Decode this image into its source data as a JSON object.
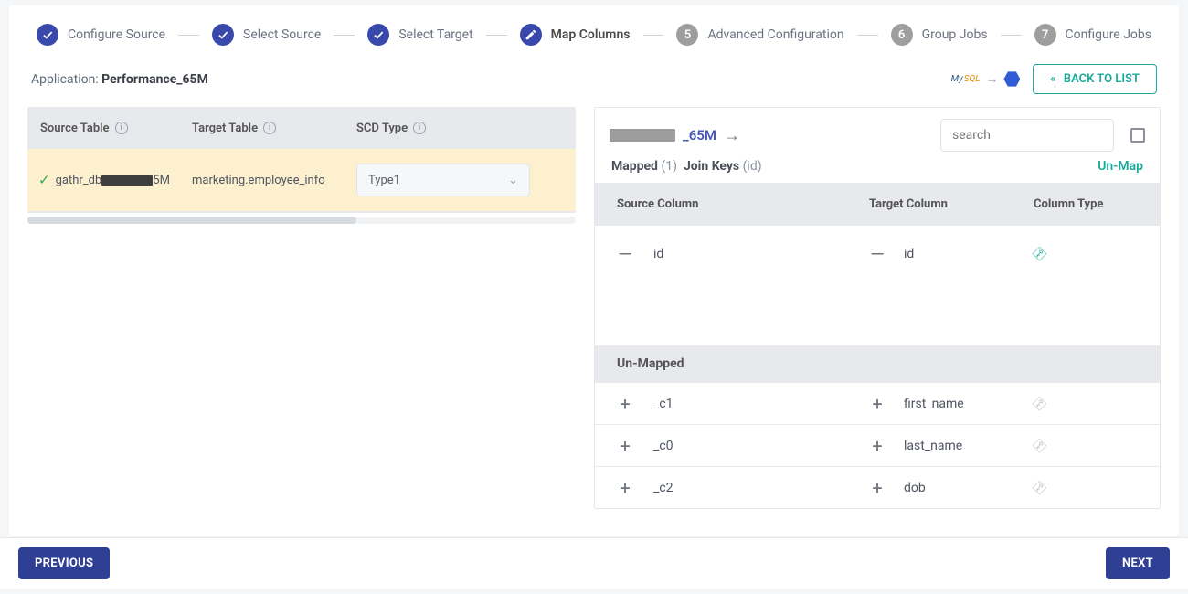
{
  "stepper": {
    "steps": [
      {
        "label": "Configure Source",
        "state": "done"
      },
      {
        "label": "Select Source",
        "state": "done"
      },
      {
        "label": "Select Target",
        "state": "done"
      },
      {
        "label": "Map Columns",
        "state": "current"
      },
      {
        "label": "Advanced Configuration",
        "state": "todo",
        "num": "5"
      },
      {
        "label": "Group Jobs",
        "state": "todo",
        "num": "6"
      },
      {
        "label": "Configure Jobs",
        "state": "todo",
        "num": "7"
      }
    ]
  },
  "header": {
    "application_label": "Application: ",
    "application_name": "Performance_65M",
    "back_to_list": "BACK TO LIST"
  },
  "left_table": {
    "headers": {
      "source": "Source Table",
      "target": "Target Table",
      "scd": "SCD Type"
    },
    "row": {
      "source_prefix": "gathr_db",
      "source_suffix": "5M",
      "target": "marketing.employee_info",
      "scd_value": "Type1"
    }
  },
  "right_panel": {
    "title_suffix": "_65M",
    "search_placeholder": "search",
    "mapped_label": "Mapped",
    "mapped_count": "(1)",
    "joinkeys_label": "Join Keys",
    "joinkeys_value": "(id)",
    "unmap": "Un-Map",
    "grid_headers": {
      "source": "Source Column",
      "target": "Target Column",
      "type": "Column Type"
    },
    "mapped_rows": [
      {
        "src": "id",
        "tgt": "id",
        "icon": "minus",
        "key": "primary"
      }
    ],
    "unmapped_label": "Un-Mapped",
    "unmapped_rows": [
      {
        "src": "_c1",
        "tgt": "first_name",
        "icon": "plus",
        "key": "gray"
      },
      {
        "src": "_c0",
        "tgt": "last_name",
        "icon": "plus",
        "key": "gray"
      },
      {
        "src": "_c2",
        "tgt": "dob",
        "icon": "plus",
        "key": "gray"
      }
    ]
  },
  "footer": {
    "previous": "PREVIOUS",
    "next": "NEXT"
  }
}
